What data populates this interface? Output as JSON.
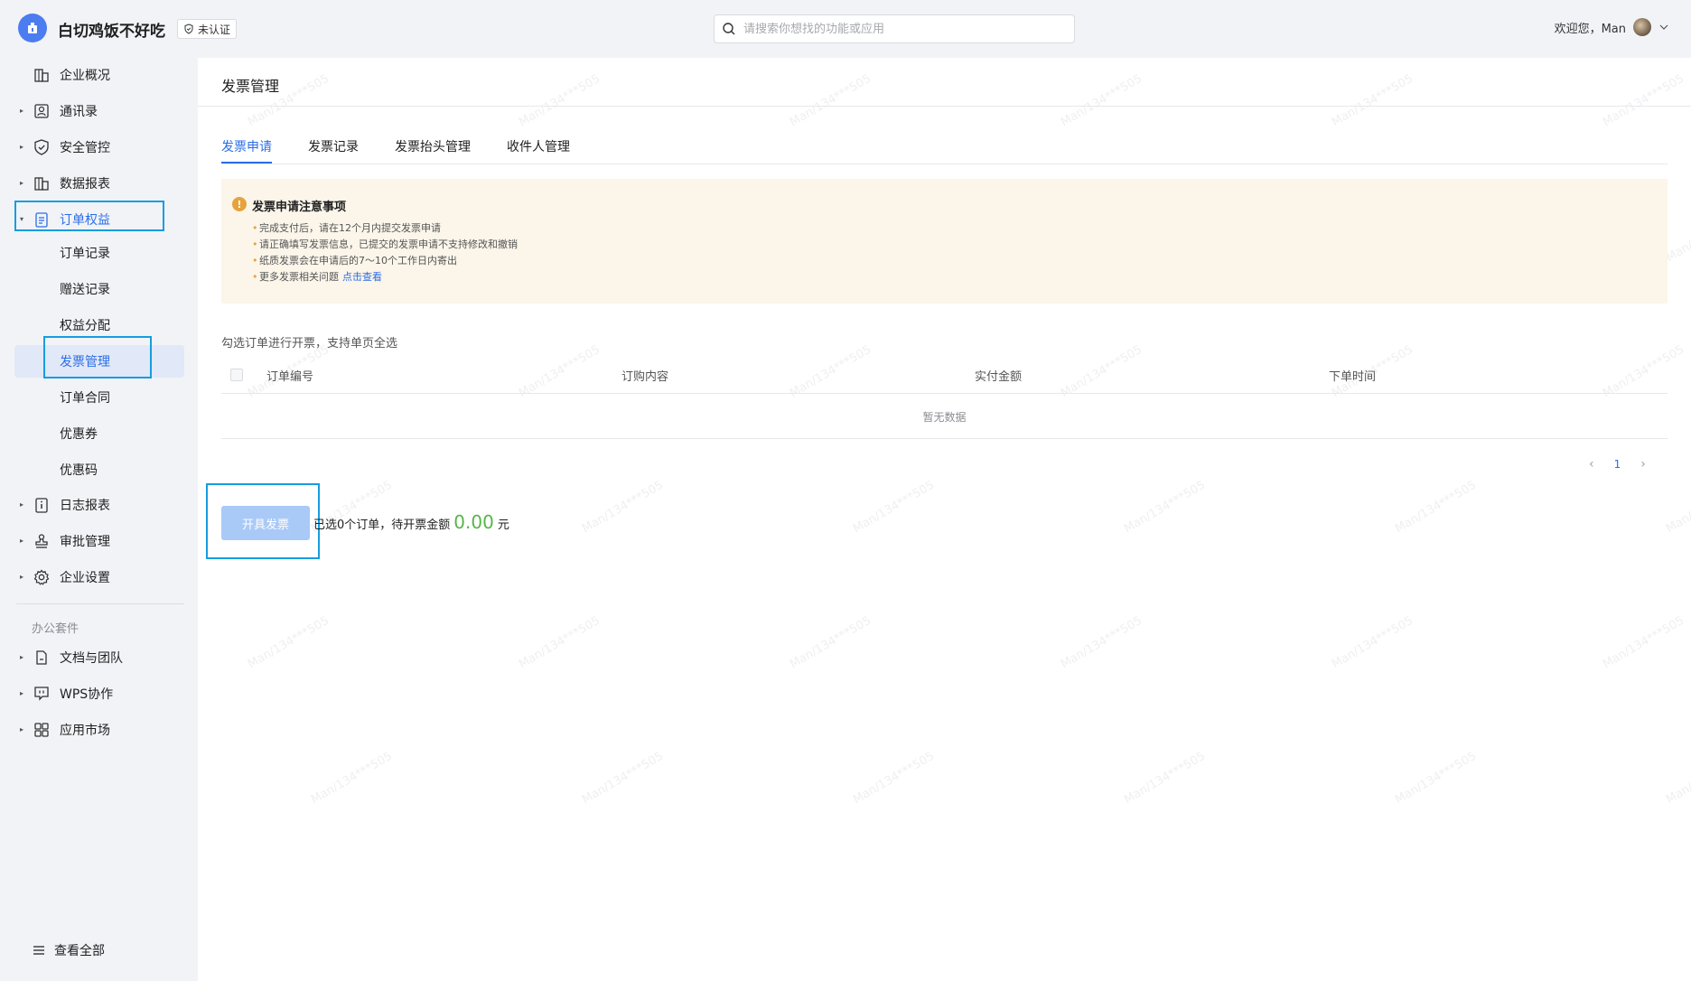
{
  "header": {
    "brand_name": "白切鸡饭不好吃",
    "cert_label": "未认证",
    "search_placeholder": "请搜索你想找的功能或应用",
    "welcome": "欢迎您，Man"
  },
  "sidebar": {
    "items": [
      {
        "label": "企业概况",
        "icon": "building-icon"
      },
      {
        "label": "通讯录",
        "icon": "contacts-icon"
      },
      {
        "label": "安全管控",
        "icon": "shield-icon"
      },
      {
        "label": "数据报表",
        "icon": "report-icon"
      },
      {
        "label": "订单权益",
        "icon": "clipboard-icon"
      }
    ],
    "sub_items": [
      {
        "label": "订单记录"
      },
      {
        "label": "赠送记录"
      },
      {
        "label": "权益分配"
      },
      {
        "label": "发票管理"
      },
      {
        "label": "订单合同"
      },
      {
        "label": "优惠券"
      },
      {
        "label": "优惠码"
      }
    ],
    "items_after": [
      {
        "label": "日志报表",
        "icon": "info-doc-icon"
      },
      {
        "label": "审批管理",
        "icon": "stamp-icon"
      },
      {
        "label": "企业设置",
        "icon": "gear-icon"
      }
    ],
    "section_label": "办公套件",
    "office_items": [
      {
        "label": "文档与团队",
        "icon": "document-icon"
      },
      {
        "label": "WPS协作",
        "icon": "chat-icon"
      },
      {
        "label": "应用市场",
        "icon": "grid-icon"
      }
    ],
    "view_all": "查看全部"
  },
  "main": {
    "page_title": "发票管理",
    "tabs": [
      {
        "label": "发票申请"
      },
      {
        "label": "发票记录"
      },
      {
        "label": "发票抬头管理"
      },
      {
        "label": "收件人管理"
      }
    ],
    "notice": {
      "title": "发票申请注意事项",
      "items": [
        "完成支付后，请在12个月内提交发票申请",
        "请正确填写发票信息，已提交的发票申请不支持修改和撤销",
        "纸质发票会在申请后的7～10个工作日内寄出",
        "更多发票相关问题"
      ],
      "link": "点击查看"
    },
    "table_hint": "勾选订单进行开票，支持单页全选",
    "columns": [
      "订单编号",
      "订购内容",
      "实付金额",
      "下单时间"
    ],
    "empty_text": "暂无数据",
    "pagination": {
      "current": "1"
    },
    "issue_button": "开具发票",
    "summary_prefix": "已选0个订单，待开票金额",
    "amount": "0.00",
    "currency_unit": "元",
    "watermark": "Man/134***505"
  },
  "colors": {
    "accent": "#2b6ee8",
    "highlight_box": "#169de0",
    "notice_bg": "#fbf5ea",
    "amount_green": "#56b649"
  }
}
